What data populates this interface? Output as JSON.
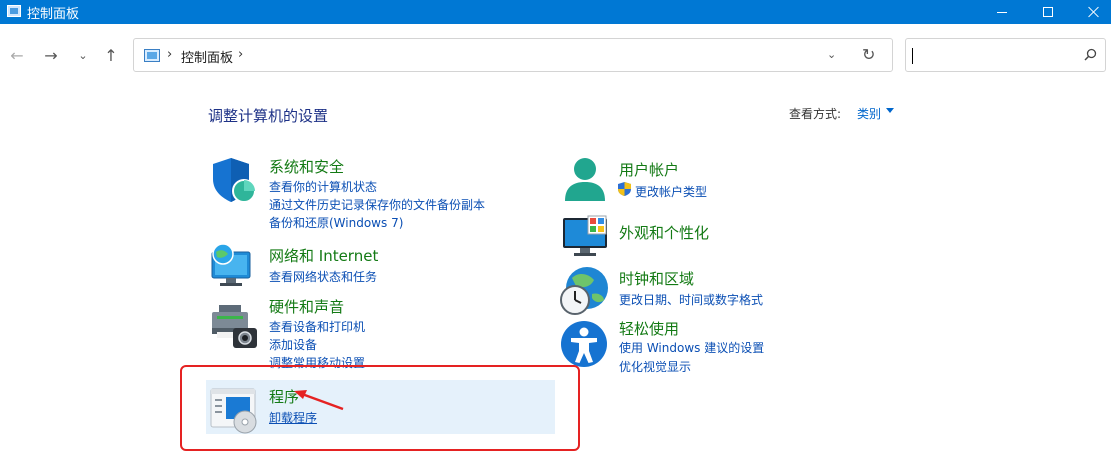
{
  "window": {
    "title": "控制面板"
  },
  "address": {
    "crumb": "控制面板",
    "separator": "›"
  },
  "search": {
    "value": ""
  },
  "nav": {
    "back": "←",
    "forward": "→",
    "recent": "⌄",
    "up": "↑",
    "refresh": "↻",
    "dropdown": "⌄"
  },
  "main": {
    "title": "调整计算机的设置",
    "view_by_label": "查看方式:",
    "view_by_value": "类别"
  },
  "categories": {
    "system": {
      "title": "系统和安全",
      "links": [
        "查看你的计算机状态",
        "通过文件历史记录保存你的文件备份副本",
        "备份和还原(Windows 7)"
      ]
    },
    "network": {
      "title": "网络和 Internet",
      "links": [
        "查看网络状态和任务"
      ]
    },
    "hardware": {
      "title": "硬件和声音",
      "links": [
        "查看设备和打印机",
        "添加设备",
        "调整常用移动设置"
      ]
    },
    "programs": {
      "title": "程序",
      "links": [
        "卸载程序"
      ]
    },
    "users": {
      "title": "用户帐户",
      "links": [
        "更改帐户类型"
      ]
    },
    "appearance": {
      "title": "外观和个性化",
      "links": []
    },
    "clock": {
      "title": "时钟和区域",
      "links": [
        "更改日期、时间或数字格式"
      ]
    },
    "ease": {
      "title": "轻松使用",
      "links": [
        "使用 Windows 建议的设置",
        "优化视觉显示"
      ]
    }
  },
  "colors": {
    "titlebar": "#0078d4",
    "category_title": "#137a14",
    "link": "#0b4fb4",
    "annotation": "#e52222",
    "highlight": "#e5f1fb"
  },
  "icons": [
    "shield-icon",
    "network-globe-icon",
    "printer-camera-icon",
    "programs-disc-icon",
    "user-icon",
    "monitor-palette-icon",
    "clock-globe-icon",
    "accessibility-icon"
  ]
}
